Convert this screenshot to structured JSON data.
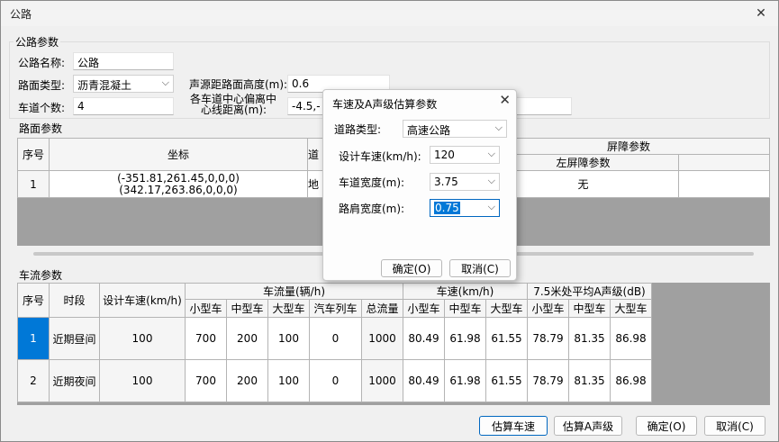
{
  "window": {
    "title": "公路",
    "close_glyph": "✕"
  },
  "road_params": {
    "group_label": "公路参数",
    "name_label": "公路名称:",
    "name_value": "公路",
    "type_label": "路面类型:",
    "type_value": "沥青混凝土",
    "lanes_label": "车道个数:",
    "lanes_value": "4",
    "source_height_label": "声源距路面高度(m):",
    "source_height_value": "0.6",
    "lane_dist_label_1": "各车道中心偏离中",
    "lane_dist_label_2": "心线距离(m):",
    "lane_dist_value": "-4.5,-"
  },
  "surface_params": {
    "group_label": "路面参数",
    "headers": {
      "index": "序号",
      "coord": "坐标",
      "road": "道",
      "barrier": "屏障参数",
      "left_barrier": "左屏障参数"
    },
    "rows": [
      {
        "index": "1",
        "coord_1": "(-351.81,261.45,0,0,0)",
        "coord_2": "(342.17,263.86,0,0,0)",
        "road": "地",
        "left_barrier": "无"
      }
    ]
  },
  "traffic_params": {
    "group_label": "车流参数",
    "headers": {
      "index": "序号",
      "period": "时段",
      "speed": "设计车速(km/h)",
      "flow": "车流量(辆/h)",
      "vel": "车速(km/h)",
      "level": "7.5米处平均A声级(dB)",
      "small": "小型车",
      "medium": "中型车",
      "large": "大型车",
      "train": "汽车列车",
      "total": "总流量"
    },
    "rows": [
      {
        "index": "1",
        "period": "近期昼间",
        "speed": "100",
        "small": "700",
        "medium": "200",
        "large": "100",
        "train": "0",
        "total": "1000",
        "v_small": "80.49",
        "v_medium": "61.98",
        "v_large": "61.55",
        "l_small": "78.79",
        "l_medium": "81.35",
        "l_large": "86.98"
      },
      {
        "index": "2",
        "period": "近期夜间",
        "speed": "100",
        "small": "700",
        "medium": "200",
        "large": "100",
        "train": "0",
        "total": "1000",
        "v_small": "80.49",
        "v_medium": "61.98",
        "v_large": "61.55",
        "l_small": "78.79",
        "l_medium": "81.35",
        "l_large": "86.98"
      }
    ]
  },
  "buttons": {
    "estimate_speed": "估算车速",
    "estimate_level": "估算A声级",
    "ok": "确定(O)",
    "cancel": "取消(C)"
  },
  "dialog": {
    "title": "车速及A声级估算参数",
    "road_type_label": "道路类型:",
    "road_type_value": "高速公路",
    "speed_label": "设计车速(km/h):",
    "speed_value": "120",
    "lane_width_label": "车道宽度(m):",
    "lane_width_value": "3.75",
    "shoulder_label": "路肩宽度(m):",
    "shoulder_value": "0.75",
    "ok": "确定(O)",
    "cancel": "取消(C)"
  },
  "colors": {
    "selection": "#0078d7",
    "grid_bg": "#a0a0a0"
  }
}
